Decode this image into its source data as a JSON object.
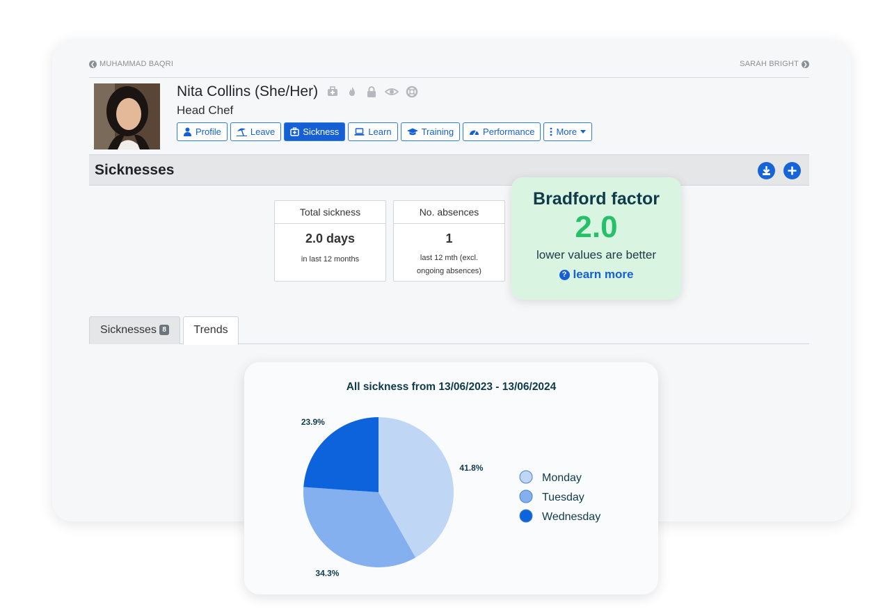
{
  "nav": {
    "prev": "MUHAMMAD BAQRI",
    "next": "SARAH BRIGHT"
  },
  "employee": {
    "name": "Nita Collins (She/Her)",
    "role": "Head Chef",
    "header_icons": [
      "medical-bag-icon",
      "fire-icon",
      "lock-icon",
      "eye-icon",
      "lifebuoy-icon"
    ]
  },
  "tabs": [
    {
      "label": "Profile",
      "icon": "user-icon",
      "active": false
    },
    {
      "label": "Leave",
      "icon": "umbrella-beach-icon",
      "active": false
    },
    {
      "label": "Sickness",
      "icon": "medical-kit-icon",
      "active": true
    },
    {
      "label": "Learn",
      "icon": "laptop-icon",
      "active": false
    },
    {
      "label": "Training",
      "icon": "graduation-cap-icon",
      "active": false
    },
    {
      "label": "Performance",
      "icon": "gauge-icon",
      "active": false
    },
    {
      "label": "More",
      "icon": "vertical-dots-icon",
      "active": false
    }
  ],
  "section": {
    "title": "Sicknesses",
    "download_icon": "download-icon",
    "add_icon": "plus-icon"
  },
  "stats": [
    {
      "head": "Total sickness",
      "value": "2.0 days",
      "sub": "in last 12 months"
    },
    {
      "head": "No. absences",
      "value": "1",
      "sub": "last 12 mth (excl. ongoing absences)"
    }
  ],
  "bradford": {
    "title": "Bradford factor",
    "value": "2.0",
    "subtitle": "lower values are better",
    "link": "learn more"
  },
  "subtabs": {
    "sicknesses_label": "Sicknesses",
    "sicknesses_count": "8",
    "trends_label": "Trends"
  },
  "chart_data": {
    "type": "pie",
    "title": "All sickness from 13/06/2023 - 13/06/2024",
    "slices": [
      {
        "label": "Monday",
        "value": 41.8,
        "display": "41.8%",
        "color": "#bfd6f5"
      },
      {
        "label": "Tuesday",
        "value": 34.3,
        "display": "34.3%",
        "color": "#84b0ef"
      },
      {
        "label": "Wednesday",
        "value": 23.9,
        "display": "23.9%",
        "color": "#0d63dc"
      }
    ],
    "legend_position": "right"
  }
}
